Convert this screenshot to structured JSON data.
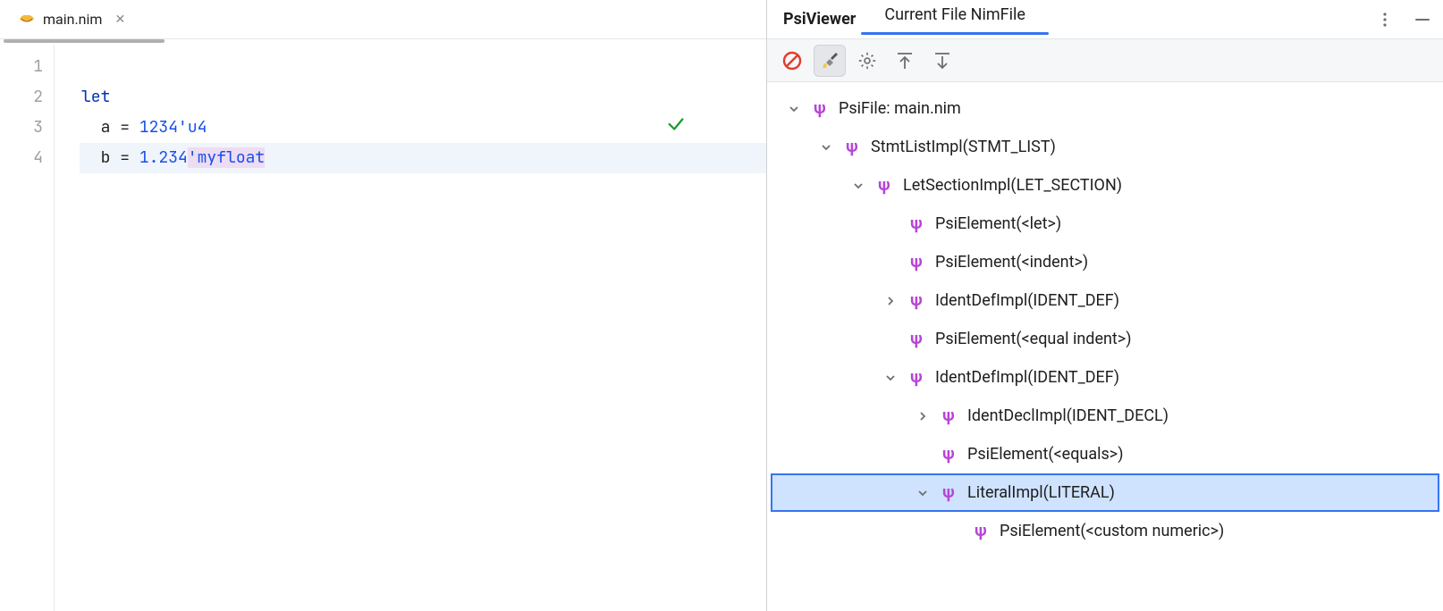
{
  "editor": {
    "tab": {
      "filename": "main.nim"
    },
    "gutter": [
      "1",
      "2",
      "3",
      "4"
    ],
    "lines": {
      "l1": {
        "kw": "let"
      },
      "l2": {
        "ident": "a",
        "eq": " = ",
        "lit": "1234'u4"
      },
      "l3": {
        "ident": "b",
        "eq": " = ",
        "lit_num": "1.234",
        "lit_sfx": "'myfloat"
      }
    }
  },
  "panel": {
    "title": "PsiViewer",
    "tab_label": "Current File NimFile"
  },
  "psi_tree": [
    {
      "depth": 0,
      "expander": "v",
      "label": "PsiFile: main.nim",
      "selected": false
    },
    {
      "depth": 1,
      "expander": "v",
      "label": "StmtListImpl(STMT_LIST)",
      "selected": false
    },
    {
      "depth": 2,
      "expander": "v",
      "label": "LetSectionImpl(LET_SECTION)",
      "selected": false
    },
    {
      "depth": 3,
      "expander": "none",
      "label": "PsiElement(<let>)",
      "selected": false
    },
    {
      "depth": 3,
      "expander": "none",
      "label": "PsiElement(<indent>)",
      "selected": false
    },
    {
      "depth": 3,
      "expander": ">",
      "label": "IdentDefImpl(IDENT_DEF)",
      "selected": false
    },
    {
      "depth": 3,
      "expander": "none",
      "label": "PsiElement(<equal indent>)",
      "selected": false
    },
    {
      "depth": 3,
      "expander": "v",
      "label": "IdentDefImpl(IDENT_DEF)",
      "selected": false
    },
    {
      "depth": 4,
      "expander": ">",
      "label": "IdentDeclImpl(IDENT_DECL)",
      "selected": false
    },
    {
      "depth": 4,
      "expander": "none",
      "label": "PsiElement(<equals>)",
      "selected": false
    },
    {
      "depth": 4,
      "expander": "v",
      "label": "LiteralImpl(LITERAL)",
      "selected": true
    },
    {
      "depth": 5,
      "expander": "none",
      "label": "PsiElement(<custom numeric>)",
      "selected": false
    }
  ]
}
